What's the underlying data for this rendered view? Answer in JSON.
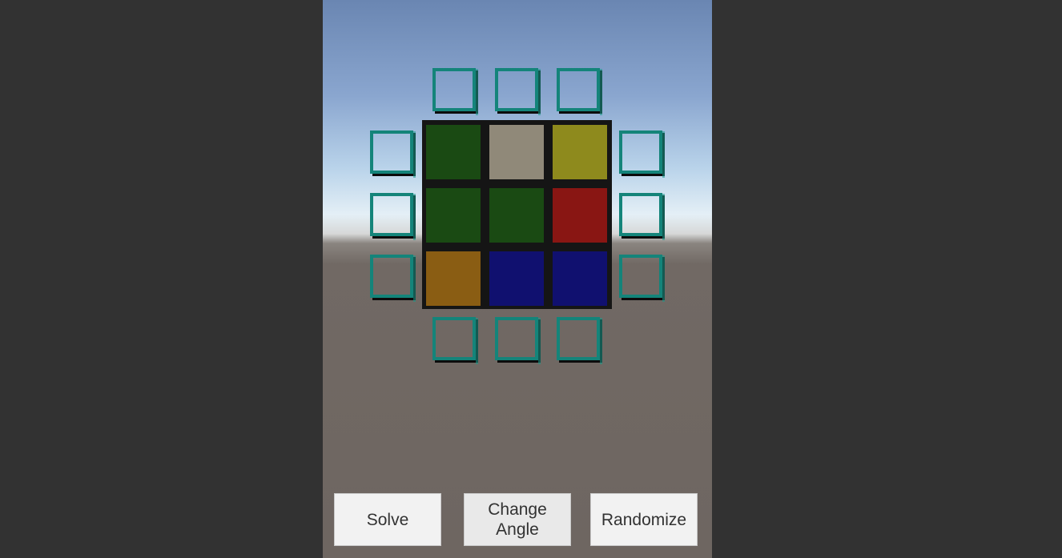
{
  "cube": {
    "faces": [
      {
        "name": "sticker-r1c1",
        "color": "#1a4a13"
      },
      {
        "name": "sticker-r1c2",
        "color": "#908979"
      },
      {
        "name": "sticker-r1c3",
        "color": "#8e8a1d"
      },
      {
        "name": "sticker-r2c1",
        "color": "#1a4a13"
      },
      {
        "name": "sticker-r2c2",
        "color": "#1a4a13"
      },
      {
        "name": "sticker-r2c3",
        "color": "#891613"
      },
      {
        "name": "sticker-r3c1",
        "color": "#8a5d13"
      },
      {
        "name": "sticker-r3c2",
        "color": "#10106f"
      },
      {
        "name": "sticker-r3c3",
        "color": "#10106f"
      }
    ],
    "slot_color": "#14847a"
  },
  "buttons": {
    "solve_label": "Solve",
    "change_angle_line1": "Change",
    "change_angle_line2": "Angle",
    "randomize_label": "Randomize"
  }
}
